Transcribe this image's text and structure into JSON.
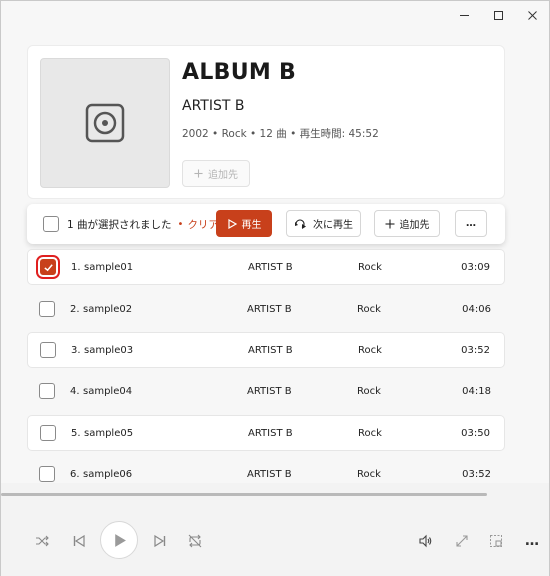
{
  "album": {
    "title": "ALBUM B",
    "artist": "ARTIST B",
    "meta": "2002 • Rock • 12 曲 • 再生時間: 45:52",
    "add_label": "追加先"
  },
  "selection_bar": {
    "count_text": "1 曲が選択されました",
    "separator": "•",
    "clear_label": "クリア",
    "play_label": "再生",
    "play_next_label": "次に再生",
    "add_label": "追加先",
    "more_label": "…"
  },
  "tracks": [
    {
      "num": "1.",
      "title": "sample01",
      "artist": "ARTIST B",
      "genre": "Rock",
      "duration": "03:09",
      "checked": true
    },
    {
      "num": "2.",
      "title": "sample02",
      "artist": "ARTIST B",
      "genre": "Rock",
      "duration": "04:06",
      "checked": false
    },
    {
      "num": "3.",
      "title": "sample03",
      "artist": "ARTIST B",
      "genre": "Rock",
      "duration": "03:52",
      "checked": false
    },
    {
      "num": "4.",
      "title": "sample04",
      "artist": "ARTIST B",
      "genre": "Rock",
      "duration": "04:18",
      "checked": false
    },
    {
      "num": "5.",
      "title": "sample05",
      "artist": "ARTIST B",
      "genre": "Rock",
      "duration": "03:50",
      "checked": false
    },
    {
      "num": "6.",
      "title": "sample06",
      "artist": "ARTIST B",
      "genre": "Rock",
      "duration": "03:52",
      "checked": false
    }
  ],
  "icons": {
    "cover": "album-cover-placeholder-icon",
    "play": "play-icon",
    "play_next": "play-next-icon",
    "add": "plus-icon",
    "more": "more-icon",
    "shuffle": "shuffle-icon",
    "previous": "previous-icon",
    "next": "next-icon",
    "repeat": "repeat-icon",
    "volume": "volume-icon",
    "fullscreen": "fullscreen-icon",
    "mini_player": "mini-player-icon"
  },
  "colors": {
    "accent": "#c8401b",
    "highlight_outline": "#e02020"
  }
}
